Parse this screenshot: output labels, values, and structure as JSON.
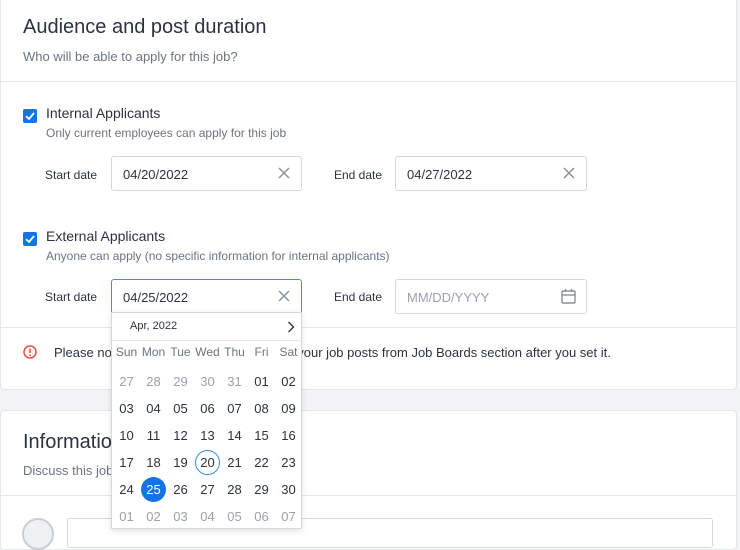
{
  "section1": {
    "title": "Audience and post duration",
    "subtitle": "Who will be able to apply for this job?",
    "internal": {
      "checked": true,
      "label": "Internal Applicants",
      "hint": "Only current employees can apply for this job",
      "start_label": "Start date",
      "start_value": "04/20/2022",
      "end_label": "End date",
      "end_value": "04/27/2022"
    },
    "external": {
      "checked": true,
      "label": "External Applicants",
      "hint": "Anyone can apply (no specific information for internal applicants)",
      "start_label": "Start date",
      "start_value": "04/25/2022",
      "end_label": "End date",
      "end_placeholder": "MM/DD/YYYY"
    },
    "notice_start": "Please no",
    "notice_end": "of your job posts from Job Boards section after you set it."
  },
  "section2": {
    "title_visible": "Informatio",
    "subtitle_visible": "Discuss this job"
  },
  "datepicker": {
    "month_label": "Apr, 2022",
    "weekdays": [
      "Sun",
      "Mon",
      "Tue",
      "Wed",
      "Thu",
      "Fri",
      "Sat"
    ],
    "weeks": [
      [
        "27",
        "28",
        "29",
        "30",
        "31",
        "01",
        "02"
      ],
      [
        "03",
        "04",
        "05",
        "06",
        "07",
        "08",
        "09"
      ],
      [
        "10",
        "11",
        "12",
        "13",
        "14",
        "15",
        "16"
      ],
      [
        "17",
        "18",
        "19",
        "20",
        "21",
        "22",
        "23"
      ],
      [
        "24",
        "25",
        "26",
        "27",
        "28",
        "29",
        "30"
      ],
      [
        "01",
        "02",
        "03",
        "04",
        "05",
        "06",
        "07"
      ]
    ],
    "today": "20",
    "selected": "25"
  },
  "colors": {
    "accent": "#1473e6",
    "warning": "#e0483a"
  }
}
